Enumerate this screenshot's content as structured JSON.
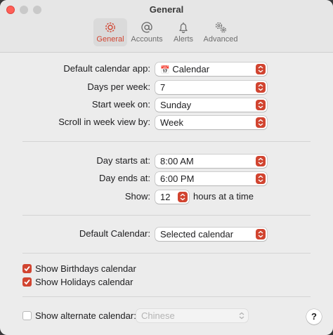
{
  "window": {
    "title": "General"
  },
  "tabs": [
    {
      "label": "General",
      "icon": "gear-icon",
      "active": true
    },
    {
      "label": "Accounts",
      "icon": "at-sign-icon",
      "active": false
    },
    {
      "label": "Alerts",
      "icon": "bell-icon",
      "active": false
    },
    {
      "label": "Advanced",
      "icon": "gears-icon",
      "active": false
    }
  ],
  "general": {
    "default_app_label": "Default calendar app:",
    "default_app_value": "Calendar",
    "default_app_icon": "📅",
    "days_per_week_label": "Days per week:",
    "days_per_week_value": "7",
    "start_week_label": "Start week on:",
    "start_week_value": "Sunday",
    "scroll_label": "Scroll in week view by:",
    "scroll_value": "Week"
  },
  "day": {
    "starts_label": "Day starts at:",
    "starts_value": "8:00 AM",
    "ends_label": "Day ends at:",
    "ends_value": "6:00 PM",
    "show_label": "Show:",
    "show_value": "12",
    "show_suffix": "hours at a time"
  },
  "default_calendar": {
    "label": "Default Calendar:",
    "value": "Selected calendar"
  },
  "checkboxes": {
    "birthdays": {
      "label": "Show Birthdays calendar",
      "checked": true
    },
    "holidays": {
      "label": "Show Holidays calendar",
      "checked": true
    }
  },
  "alternate": {
    "label": "Show alternate calendar:",
    "checked": false,
    "value": "Chinese"
  },
  "help": {
    "label": "?"
  },
  "colors": {
    "accent": "#d14430"
  }
}
